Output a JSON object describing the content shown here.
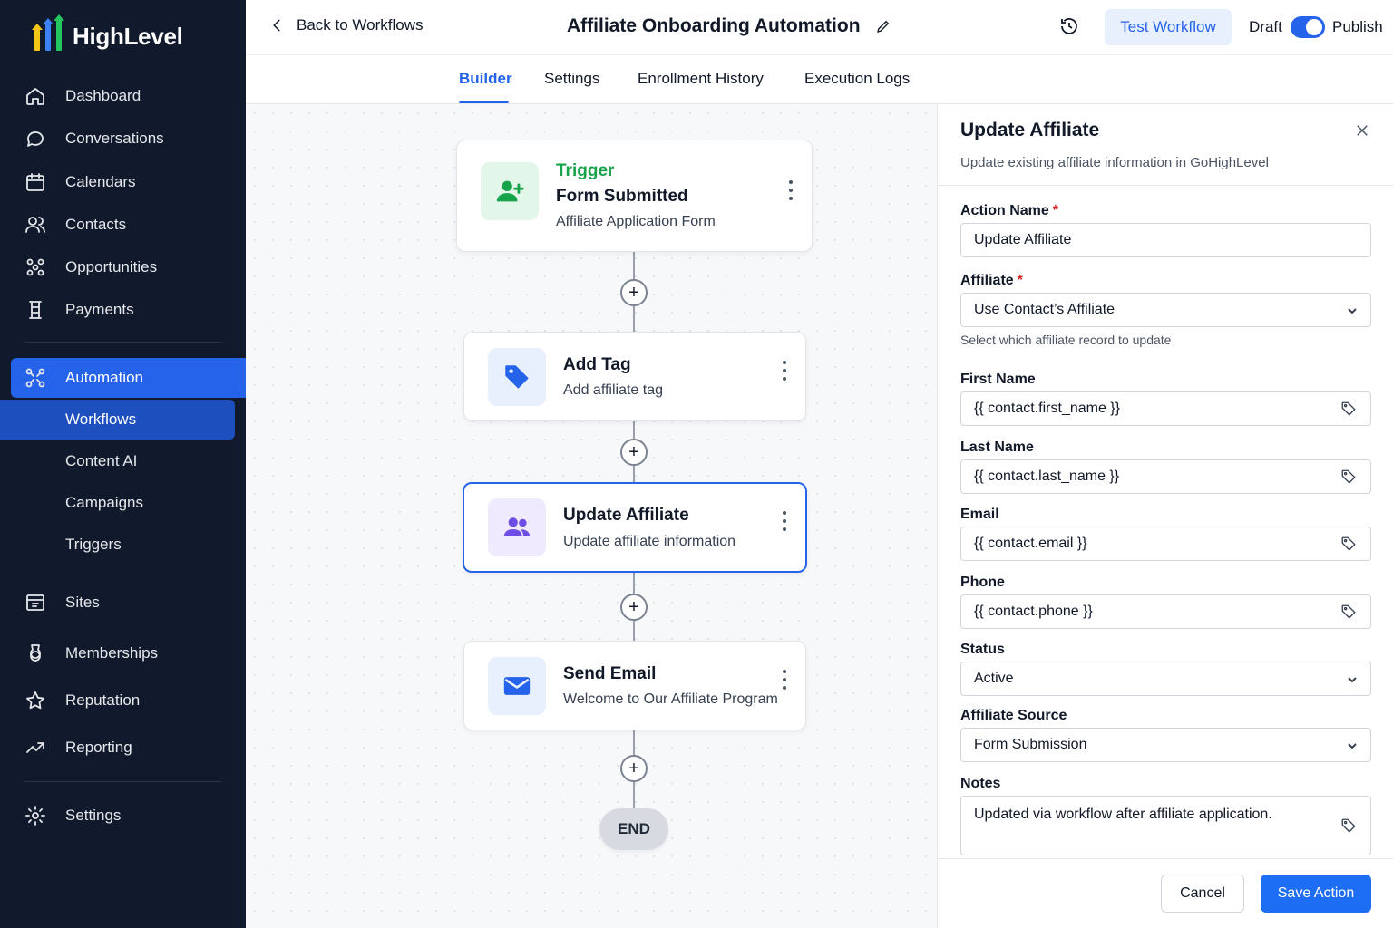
{
  "brand": {
    "name": "HighLevel"
  },
  "sidebar": {
    "items": [
      {
        "label": "Dashboard",
        "icon": "home-icon"
      },
      {
        "label": "Conversations",
        "icon": "chat-bubble-icon"
      },
      {
        "label": "Calendars",
        "icon": "calendar-icon"
      },
      {
        "label": "Contacts",
        "icon": "users-icon"
      },
      {
        "label": "Opportunities",
        "icon": "pipeline-icon"
      },
      {
        "label": "Payments",
        "icon": "payments-icon"
      },
      {
        "label": "Automation",
        "icon": "automation-icon"
      },
      {
        "label": "Sites",
        "icon": "sites-icon"
      },
      {
        "label": "Memberships",
        "icon": "memberships-icon"
      },
      {
        "label": "Reputation",
        "icon": "star-icon"
      },
      {
        "label": "Reporting",
        "icon": "trend-icon"
      },
      {
        "label": "Settings",
        "icon": "gear-icon"
      }
    ],
    "automation_sub": [
      "Workflows",
      "Content AI",
      "Campaigns",
      "Triggers"
    ],
    "active_item": "Automation",
    "active_sub": "Workflows",
    "accent": "#2563eb"
  },
  "topbar": {
    "back_label": "Back to Workflows",
    "title": "Affiliate Onboarding Automation",
    "test_button": "Test Workflow",
    "draft_label": "Draft",
    "publish_label": "Publish",
    "publish_toggle_on": true
  },
  "tabs": {
    "items": [
      "Builder",
      "Settings",
      "Enrollment History",
      "Execution Logs"
    ],
    "active": "Builder"
  },
  "workflow": {
    "nodes": [
      {
        "kicker": "Trigger",
        "title": "Form Submitted",
        "subtitle": "Affiliate Application Form",
        "icon": "user-plus-icon",
        "color": "#16a34a"
      },
      {
        "title": "Add Tag",
        "subtitle": "Add affiliate tag",
        "icon": "tag-icon",
        "color": "#2563eb"
      },
      {
        "title": "Update Affiliate",
        "subtitle": "Update affiliate information",
        "icon": "users-icon",
        "color": "#6d4de6",
        "selected": true
      },
      {
        "title": "Send Email",
        "subtitle": "Welcome to Our Affiliate Program",
        "icon": "mail-icon",
        "color": "#2563eb"
      }
    ],
    "end_label": "END",
    "add_button_symbol": "+"
  },
  "panel": {
    "title": "Update Affiliate",
    "description": "Update existing affiliate information in GoHighLevel",
    "fields": {
      "action_name": {
        "label": "Action Name",
        "required": true,
        "value": "Update Affiliate"
      },
      "affiliate": {
        "label": "Affiliate",
        "required": true,
        "value": "Use Contact’s Affiliate",
        "helper": "Select which affiliate record to update"
      },
      "first_name": {
        "label": "First Name",
        "value": "{{ contact.first_name }}"
      },
      "last_name": {
        "label": "Last Name",
        "value": "{{ contact.last_name }}"
      },
      "email": {
        "label": "Email",
        "value": "{{ contact.email }}"
      },
      "phone": {
        "label": "Phone",
        "value": "{{ contact.phone }}"
      },
      "status": {
        "label": "Status",
        "value": "Active"
      },
      "affiliate_source": {
        "label": "Affiliate Source",
        "value": "Form Submission"
      },
      "notes": {
        "label": "Notes",
        "value": "Updated via workflow after affiliate application."
      }
    },
    "required_marker": "*",
    "cancel_label": "Cancel",
    "save_label": "Save Action"
  }
}
